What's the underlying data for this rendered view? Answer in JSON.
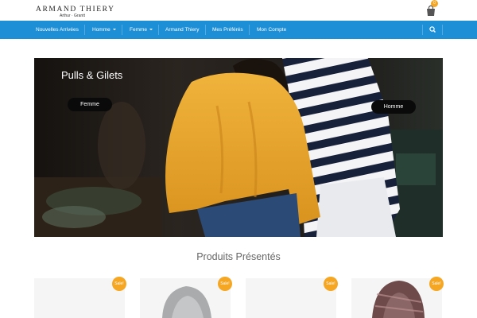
{
  "header": {
    "logo_main": "ARMAND THIERY",
    "logo_sub": "Arthur · Grantt",
    "cart_count": "0"
  },
  "nav": {
    "items": [
      {
        "label": "Nouvelles Arrivées"
      },
      {
        "label": "Homme"
      },
      {
        "label": "Femme"
      },
      {
        "label": "Armand Thiery"
      },
      {
        "label": "Mes Préférés"
      },
      {
        "label": "Mon Compte"
      }
    ]
  },
  "hero": {
    "title": "Pulls & Gilets",
    "buttons": [
      {
        "label": "Femme"
      },
      {
        "label": "Homme"
      }
    ]
  },
  "featured": {
    "title": "Produits Présentés",
    "products": [
      {
        "badge": "Sale!"
      },
      {
        "badge": "Sale!"
      },
      {
        "badge": "Sale!"
      },
      {
        "badge": "Sale!"
      }
    ]
  },
  "colors": {
    "nav_bg": "#1c8fd6",
    "badge": "#f5a623",
    "sweater": "#e9a92e"
  }
}
